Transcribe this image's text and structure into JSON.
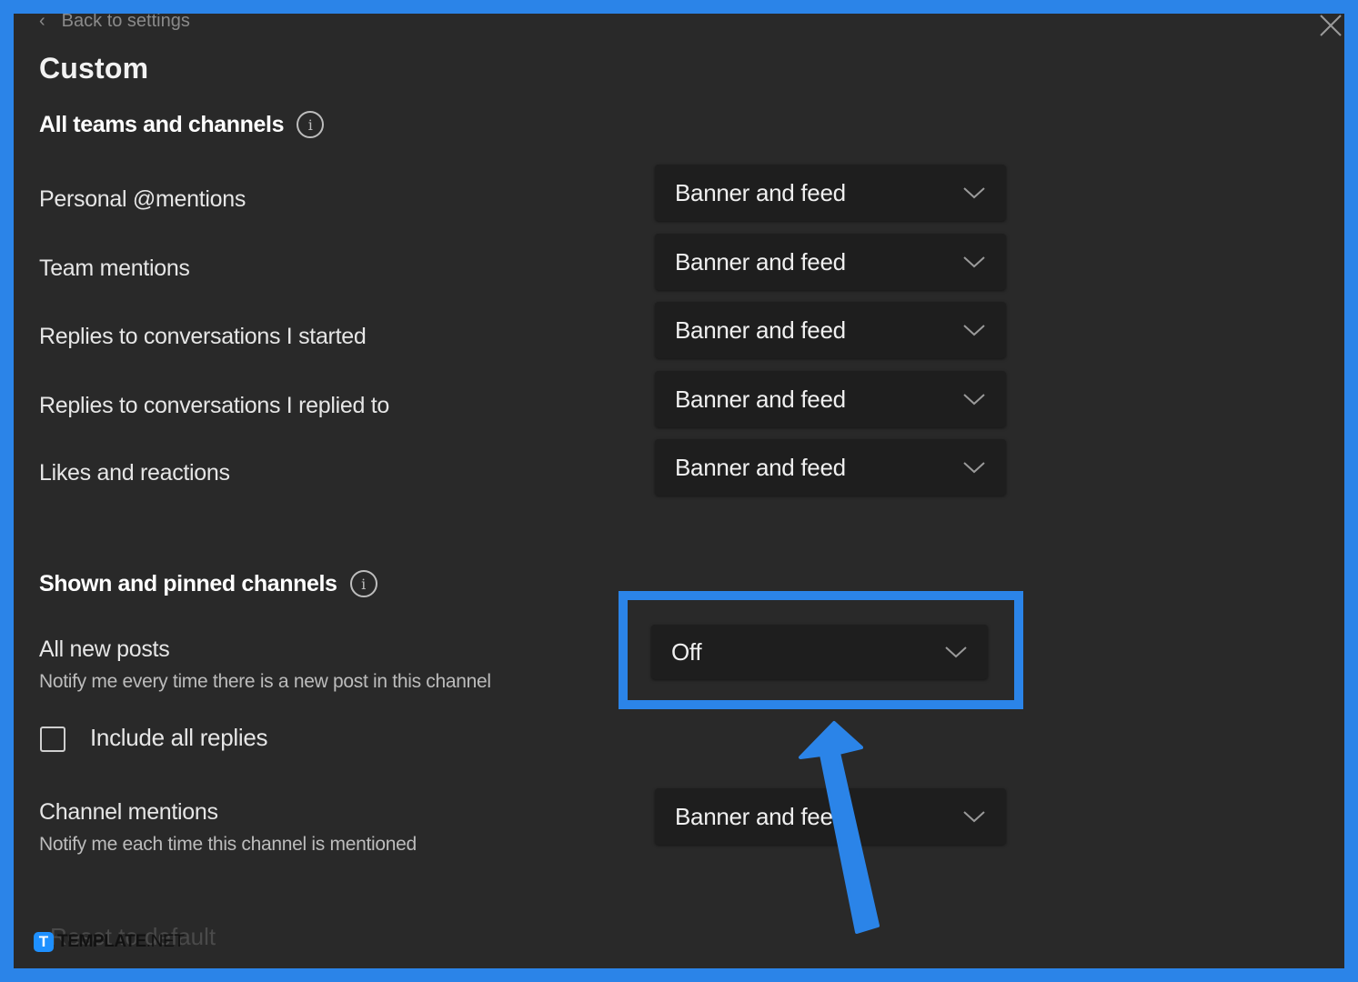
{
  "header": {
    "back_label": "Back to settings",
    "title": "Custom"
  },
  "sections": [
    {
      "title": "All teams and channels",
      "info_icon": "info-icon",
      "rows": [
        {
          "label": "Personal @mentions",
          "value": "Banner and feed"
        },
        {
          "label": "Team mentions",
          "value": "Banner and feed"
        },
        {
          "label": "Replies to conversations I started",
          "value": "Banner and feed"
        },
        {
          "label": "Replies to conversations I replied to",
          "value": "Banner and feed"
        },
        {
          "label": "Likes and reactions",
          "value": "Banner and feed"
        }
      ]
    },
    {
      "title": "Shown and pinned channels",
      "info_icon": "info-icon",
      "rows": [
        {
          "label": "All new posts",
          "description": "Notify me every time there is a new post in this channel",
          "value": "Off"
        },
        {
          "label": "Channel mentions",
          "description": "Notify me each time this channel is mentioned",
          "value": "Banner and feed"
        }
      ],
      "checkbox": {
        "label": "Include all replies",
        "checked": false
      }
    }
  ],
  "footer": {
    "reset_label": "Reset to default"
  },
  "watermark": {
    "logo_letter": "T",
    "brand": "TEMPLATE",
    "suffix": ".NET"
  },
  "annotation": {
    "color": "#2b84e8",
    "highlighted": "All new posts dropdown"
  }
}
